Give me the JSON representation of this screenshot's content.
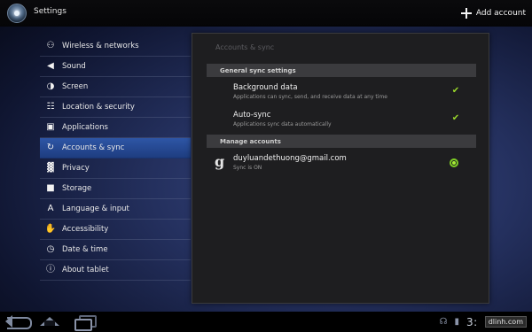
{
  "actionbar": {
    "title": "Settings",
    "app_icon": "settings-app-icon",
    "add_account_icon": "plus-icon",
    "add_account_label": "Add account"
  },
  "menu": {
    "items": [
      {
        "label": "Wireless & networks",
        "icon": "wifi-icon",
        "glyph": "⚇",
        "selected": false
      },
      {
        "label": "Sound",
        "icon": "speaker-icon",
        "glyph": "◀",
        "selected": false
      },
      {
        "label": "Screen",
        "icon": "brightness-icon",
        "glyph": "◑",
        "selected": false
      },
      {
        "label": "Location & security",
        "icon": "grid-lock-icon",
        "glyph": "☷",
        "selected": false
      },
      {
        "label": "Applications",
        "icon": "apps-icon",
        "glyph": "▣",
        "selected": false
      },
      {
        "label": "Accounts & sync",
        "icon": "sync-arrows-icon",
        "glyph": "↻",
        "selected": true
      },
      {
        "label": "Privacy",
        "icon": "privacy-icon",
        "glyph": "▓",
        "selected": false
      },
      {
        "label": "Storage",
        "icon": "storage-icon",
        "glyph": "■",
        "selected": false
      },
      {
        "label": "Language & input",
        "icon": "language-icon",
        "glyph": "A",
        "selected": false
      },
      {
        "label": "Accessibility",
        "icon": "hand-icon",
        "glyph": "✋",
        "selected": false
      },
      {
        "label": "Date & time",
        "icon": "clock-icon",
        "glyph": "◷",
        "selected": false
      },
      {
        "label": "About tablet",
        "icon": "info-icon",
        "glyph": "ⓘ",
        "selected": false
      }
    ]
  },
  "panel": {
    "title": "Accounts & sync",
    "general_header": "General sync settings",
    "background_data": {
      "title": "Background data",
      "subtitle": "Applications can sync, send, and receive data at any time",
      "checked": true
    },
    "auto_sync": {
      "title": "Auto-sync",
      "subtitle": "Applications sync data automatically",
      "checked": true
    },
    "manage_header": "Manage accounts",
    "account": {
      "icon": "google-icon",
      "glyph": "g",
      "email": "duyluandethuong@gmail.com",
      "status": "Sync is ON",
      "sync_indicator": "sync-on-indicator"
    },
    "checkmark_glyph": "✔",
    "accent_color": "#9ad82a"
  },
  "systembar": {
    "back_icon": "back-icon",
    "home_icon": "home-icon",
    "recent_icon": "recent-apps-icon",
    "headset_glyph": "☊",
    "battery_glyph": "▮",
    "clock": "3:",
    "watermark": "dlinh.com"
  }
}
